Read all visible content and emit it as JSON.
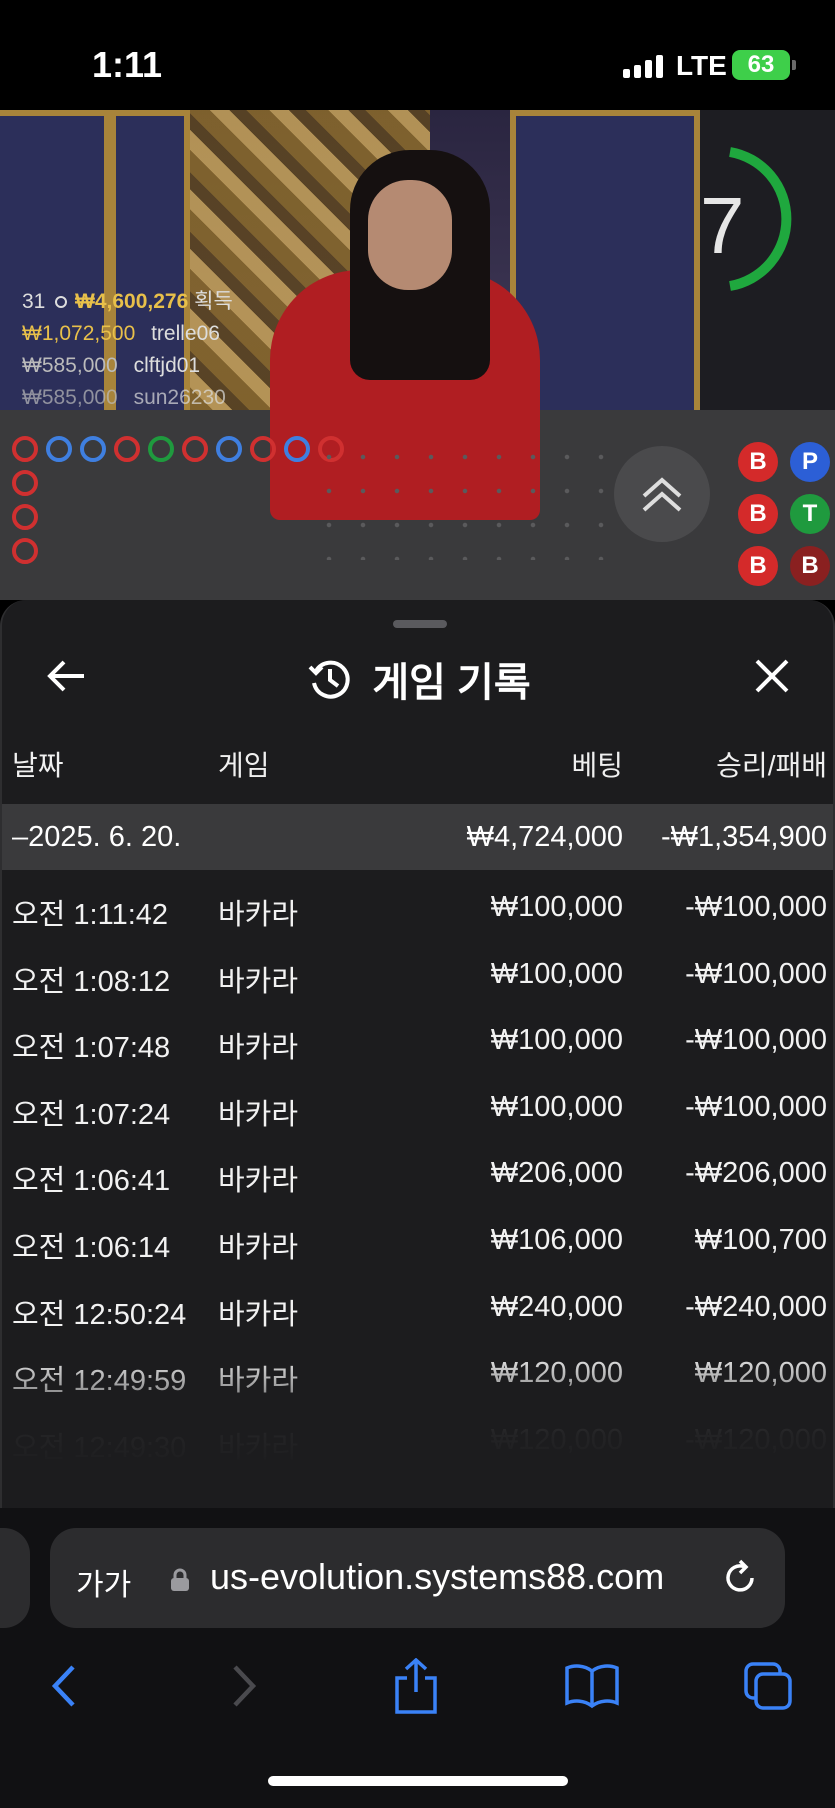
{
  "status_bar": {
    "time": "1:11",
    "network": "LTE",
    "battery": "63"
  },
  "video": {
    "timer": "7",
    "winners_summary_count": "31",
    "winners_summary_amount": "₩4,600,276",
    "winners_summary_suffix": "획득",
    "winners": [
      {
        "amount": "₩1,072,500",
        "name": "trelle06"
      },
      {
        "amount": "₩585,000",
        "name": "clftjd01"
      },
      {
        "amount": "₩585,000",
        "name": "sun26230"
      }
    ],
    "bead_labels": [
      "B",
      "P",
      "B",
      "T",
      "B",
      "B"
    ],
    "colors": {
      "banker": "#d42a2a",
      "player": "#2c5fd6",
      "tie": "#1f9a3e"
    }
  },
  "sheet": {
    "title": "게임 기록",
    "back_icon": "arrow-left-icon",
    "history_icon": "history-clock-icon",
    "close_icon": "close-icon",
    "columns": {
      "date": "날짜",
      "game": "게임",
      "bet": "베팅",
      "win_loss": "승리/패배"
    },
    "day": {
      "date": "–2025. 6. 20.",
      "bet": "₩4,724,000",
      "win_loss": "-₩1,354,900"
    },
    "rows": [
      {
        "time": "오전 1:11:42",
        "game": "바카라",
        "bet": "₩100,000",
        "win_loss": "-₩100,000"
      },
      {
        "time": "오전 1:08:12",
        "game": "바카라",
        "bet": "₩100,000",
        "win_loss": "-₩100,000"
      },
      {
        "time": "오전 1:07:48",
        "game": "바카라",
        "bet": "₩100,000",
        "win_loss": "-₩100,000"
      },
      {
        "time": "오전 1:07:24",
        "game": "바카라",
        "bet": "₩100,000",
        "win_loss": "-₩100,000"
      },
      {
        "time": "오전 1:06:41",
        "game": "바카라",
        "bet": "₩206,000",
        "win_loss": "-₩206,000"
      },
      {
        "time": "오전 1:06:14",
        "game": "바카라",
        "bet": "₩106,000",
        "win_loss": "₩100,700"
      },
      {
        "time": "오전 12:50:24",
        "game": "바카라",
        "bet": "₩240,000",
        "win_loss": "-₩240,000"
      },
      {
        "time": "오전 12:49:59",
        "game": "바카라",
        "bet": "₩120,000",
        "win_loss": "₩120,000"
      },
      {
        "time": "오전 12:49:30",
        "game": "바카라",
        "bet": "₩120,000",
        "win_loss": "-₩120,000"
      }
    ]
  },
  "browser": {
    "text_size_label": "가가",
    "url": "us-evolution.systems88.com"
  }
}
